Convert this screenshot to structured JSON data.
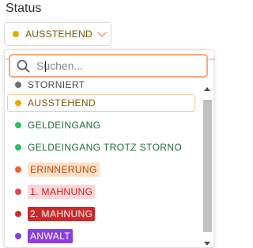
{
  "field": {
    "label": "Status"
  },
  "select": {
    "value": "AUSSTEHEND",
    "dot_color": "#e5ac00",
    "icon": "chevron-down-icon",
    "expanded": true
  },
  "search": {
    "placeholder": "Suchen...",
    "value": "",
    "icon": "search-icon"
  },
  "options": [
    {
      "label": "STORNIERT",
      "dot_color": "#6b6f76",
      "text_color": "#4a4a4a",
      "bg": "",
      "selected": false
    },
    {
      "label": "AUSSTEHEND",
      "dot_color": "#e5ac00",
      "text_color": "#7a5800",
      "bg": "",
      "selected": true
    },
    {
      "label": "GELDEINGANG",
      "dot_color": "#22c55e",
      "text_color": "#1f6b3a",
      "bg": "",
      "selected": false
    },
    {
      "label": "GELDEINGANG TROTZ STORNO",
      "dot_color": "#22c55e",
      "text_color": "#1f6b3a",
      "bg": "",
      "selected": false
    },
    {
      "label": "ERINNERUNG",
      "dot_color": "#f15f2c",
      "text_color": "#c2410c",
      "bg": "#fde0c6",
      "selected": false
    },
    {
      "label": "1. MAHNUNG",
      "dot_color": "#e04848",
      "text_color": "#c81e1e",
      "bg": "#fdd6d6",
      "selected": false
    },
    {
      "label": "2. MAHNUNG",
      "dot_color": "#d22d2d",
      "text_color": "#ffffff",
      "bg": "#cc2a2a",
      "selected": false
    },
    {
      "label": "ANWALT",
      "dot_color": "#8b3fe0",
      "text_color": "#ffffff",
      "bg": "#8b3fe0",
      "selected": false
    }
  ],
  "accent_color": "#f39b6d"
}
